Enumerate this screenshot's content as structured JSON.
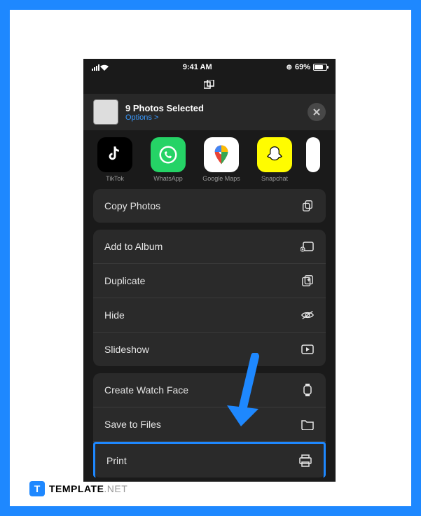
{
  "statusbar": {
    "time": "9:41 AM",
    "battery": "69%"
  },
  "header": {
    "title": "9 Photos Selected",
    "options": "Options >"
  },
  "apps": [
    {
      "name": "TikTok"
    },
    {
      "name": "WhatsApp"
    },
    {
      "name": "Google Maps"
    },
    {
      "name": "Snapchat"
    }
  ],
  "actions": {
    "group1": [
      {
        "label": "Copy Photos",
        "icon": "copy"
      }
    ],
    "group2": [
      {
        "label": "Add to Album",
        "icon": "album"
      },
      {
        "label": "Duplicate",
        "icon": "duplicate"
      },
      {
        "label": "Hide",
        "icon": "hide"
      },
      {
        "label": "Slideshow",
        "icon": "slideshow"
      }
    ],
    "group3": [
      {
        "label": "Create Watch Face",
        "icon": "watch"
      },
      {
        "label": "Save to Files",
        "icon": "folder"
      },
      {
        "label": "Print",
        "icon": "print"
      }
    ]
  },
  "branding": {
    "name": "TEMPLATE",
    "suffix": ".NET",
    "icon": "T"
  }
}
